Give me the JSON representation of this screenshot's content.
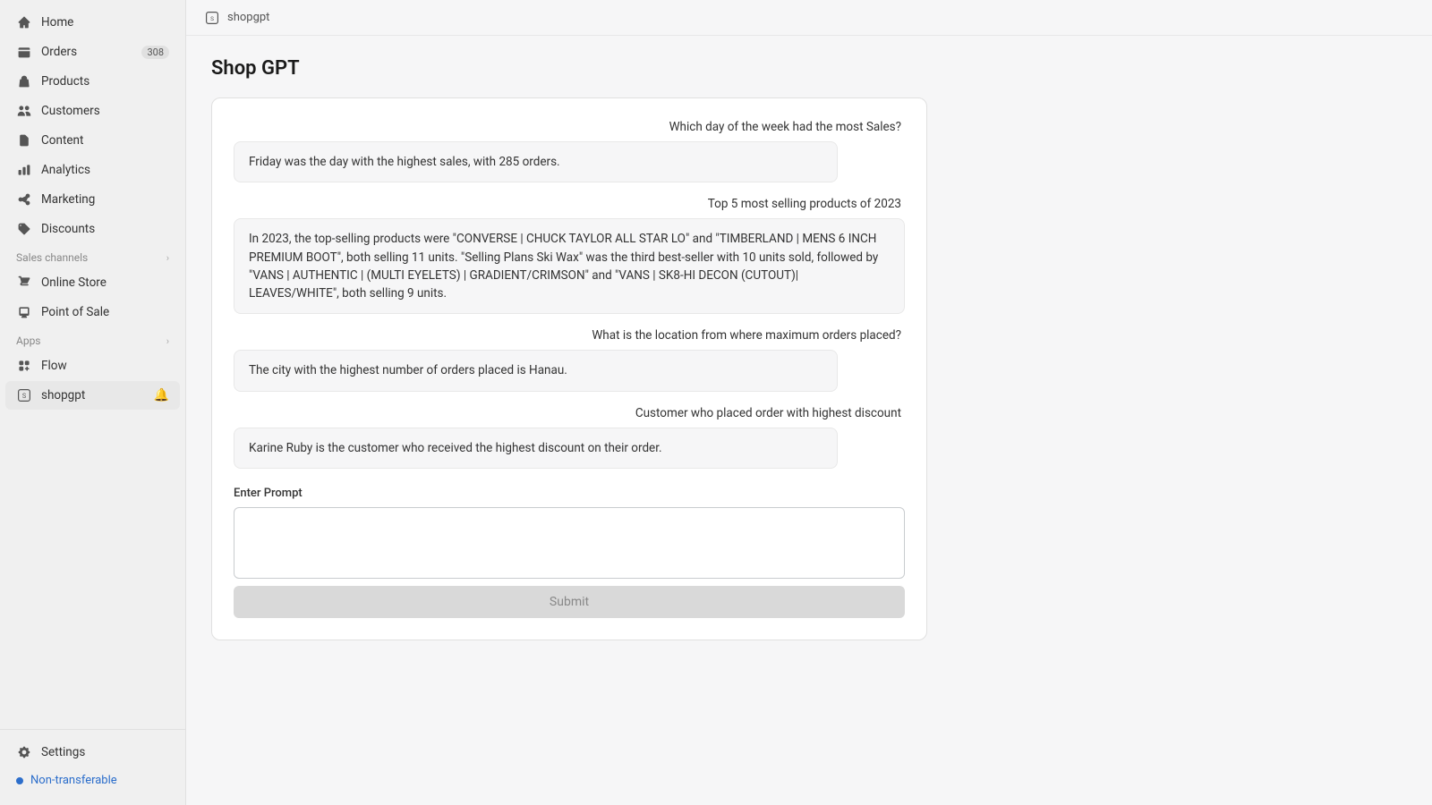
{
  "sidebar": {
    "items": [
      {
        "id": "home",
        "label": "Home",
        "icon": "home"
      },
      {
        "id": "orders",
        "label": "Orders",
        "icon": "orders",
        "badge": "308"
      },
      {
        "id": "products",
        "label": "Products",
        "icon": "products"
      },
      {
        "id": "customers",
        "label": "Customers",
        "icon": "customers"
      },
      {
        "id": "content",
        "label": "Content",
        "icon": "content"
      },
      {
        "id": "analytics",
        "label": "Analytics",
        "icon": "analytics"
      },
      {
        "id": "marketing",
        "label": "Marketing",
        "icon": "marketing"
      },
      {
        "id": "discounts",
        "label": "Discounts",
        "icon": "discounts"
      }
    ],
    "sales_channels_label": "Sales channels",
    "sales_channels": [
      {
        "id": "online-store",
        "label": "Online Store",
        "icon": "store"
      },
      {
        "id": "point-of-sale",
        "label": "Point of Sale",
        "icon": "pos"
      }
    ],
    "apps_label": "Apps",
    "apps": [
      {
        "id": "flow",
        "label": "Flow",
        "icon": "flow"
      },
      {
        "id": "shopgpt",
        "label": "shopgpt",
        "icon": "shopgpt"
      }
    ],
    "bottom_items": [
      {
        "id": "settings",
        "label": "Settings",
        "icon": "settings"
      }
    ],
    "non_transferable": "Non-transferable"
  },
  "topbar": {
    "icon_name": "shopgpt-icon",
    "title": "shopgpt"
  },
  "page": {
    "title": "Shop GPT"
  },
  "chat": {
    "messages": [
      {
        "question": "Which day of the week had the most Sales?",
        "answer": "Friday was the day with the highest sales, with 285 orders."
      },
      {
        "question": "Top 5 most selling products of 2023",
        "answer": "In 2023, the top-selling products were \"CONVERSE | CHUCK TAYLOR ALL STAR LO\" and \"TIMBERLAND | MENS 6 INCH PREMIUM BOOT\", both selling 11 units. \"Selling Plans Ski Wax\" was the third best-seller with 10 units sold, followed by \"VANS | AUTHENTIC | (MULTI EYELETS) | GRADIENT/CRIMSON\" and \"VANS | SK8-HI DECON (CUTOUT)| LEAVES/WHITE\", both selling 9 units."
      },
      {
        "question": "What is the location from where maximum orders placed?",
        "answer": "The city with the highest number of orders placed is Hanau."
      },
      {
        "question": "Customer who placed order with highest discount",
        "answer": "Karine Ruby is the customer who received the highest discount on their order."
      }
    ],
    "input_label": "Enter Prompt",
    "input_placeholder": "",
    "submit_label": "Submit"
  }
}
